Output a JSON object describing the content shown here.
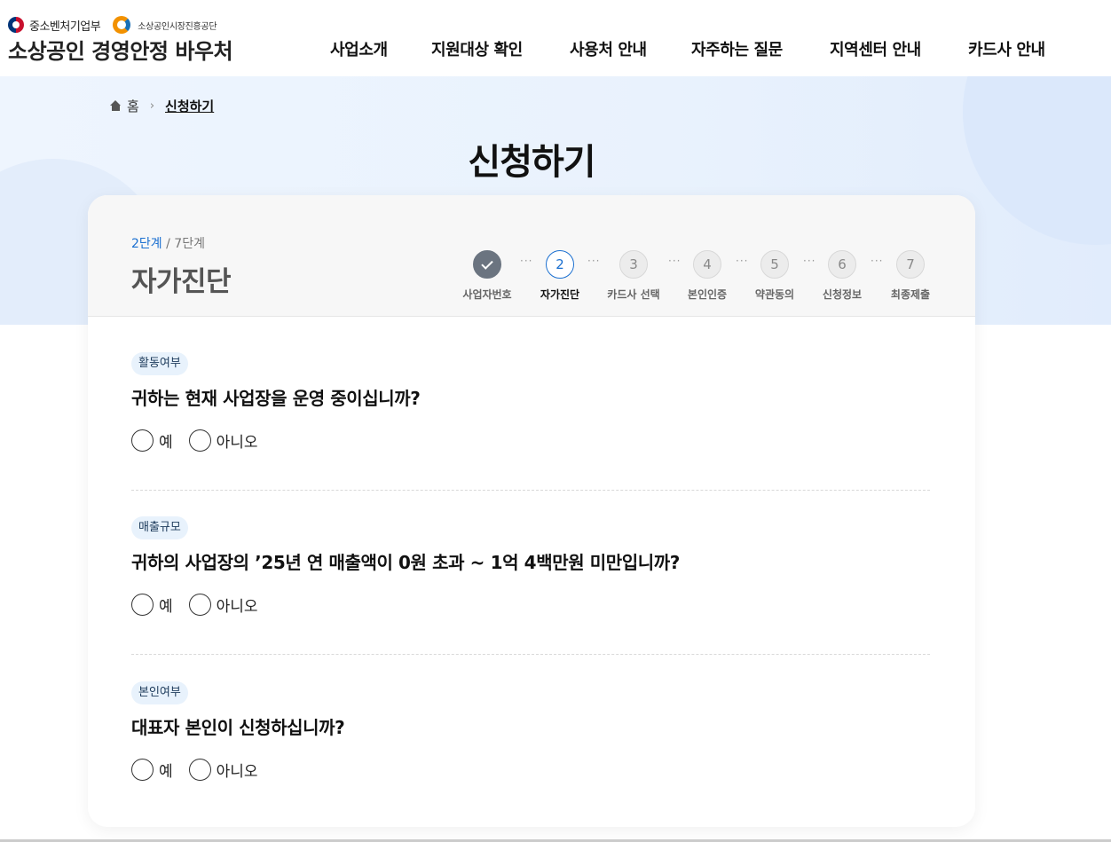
{
  "header": {
    "gov_name": "중소벤처기업부",
    "agency_name": "소상공인시장진흥공단",
    "logo_title": "소상공인 경영안정 바우처",
    "nav": [
      "사업소개",
      "지원대상 확인",
      "사용처 안내",
      "자주하는 질문",
      "지역센터 안내",
      "카드사 안내"
    ]
  },
  "breadcrumb": {
    "home": "홈",
    "separator": "›",
    "current": "신청하기"
  },
  "page_title": "신청하기",
  "progress": {
    "current_step": "2단계",
    "separator": " / ",
    "total_steps": "7단계",
    "title": "자가진단",
    "steps": [
      {
        "number": "",
        "label": "사업자번호",
        "state": "done"
      },
      {
        "number": "2",
        "label": "자가진단",
        "state": "active"
      },
      {
        "number": "3",
        "label": "카드사 선택",
        "state": "pending"
      },
      {
        "number": "4",
        "label": "본인인증",
        "state": "pending"
      },
      {
        "number": "5",
        "label": "약관동의",
        "state": "pending"
      },
      {
        "number": "6",
        "label": "신청정보",
        "state": "pending"
      },
      {
        "number": "7",
        "label": "최종제출",
        "state": "pending"
      }
    ],
    "dots": "···"
  },
  "questions": [
    {
      "tag": "활동여부",
      "text": "귀하는 현재 사업장을 운영 중이십니까?",
      "yes": "예",
      "no": "아니오"
    },
    {
      "tag": "매출규모",
      "text": "귀하의 사업장의 ’25년 연 매출액이 0원 초과 ~ 1억 4백만원 미만입니까?",
      "yes": "예",
      "no": "아니오"
    },
    {
      "tag": "본인여부",
      "text": "대표자 본인이 신청하십니까?",
      "yes": "예",
      "no": "아니오"
    }
  ],
  "colors": {
    "accent": "#1a6fd0",
    "done_step": "#6b7480",
    "hero_bg": "#eef5fe",
    "tag_bg": "#e8f2fc"
  }
}
